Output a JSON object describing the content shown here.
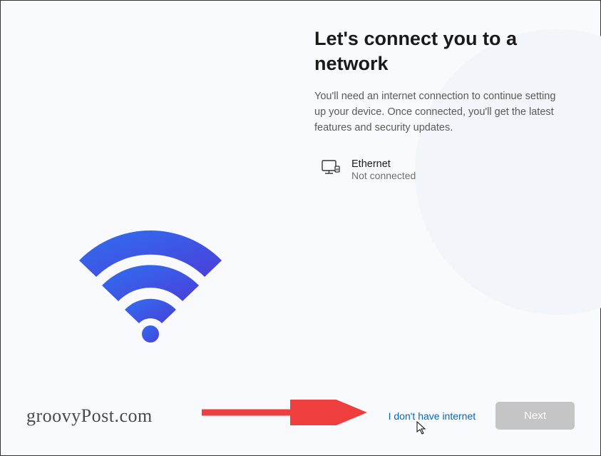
{
  "heading": "Let's connect you to a network",
  "subheading": "You'll need an internet connection to continue setting up your device. Once connected, you'll get the latest features and security updates.",
  "network": {
    "name": "Ethernet",
    "status": "Not connected"
  },
  "actions": {
    "skip_link": "I don't have internet",
    "next_button": "Next"
  },
  "watermark": "groovyPost.com"
}
